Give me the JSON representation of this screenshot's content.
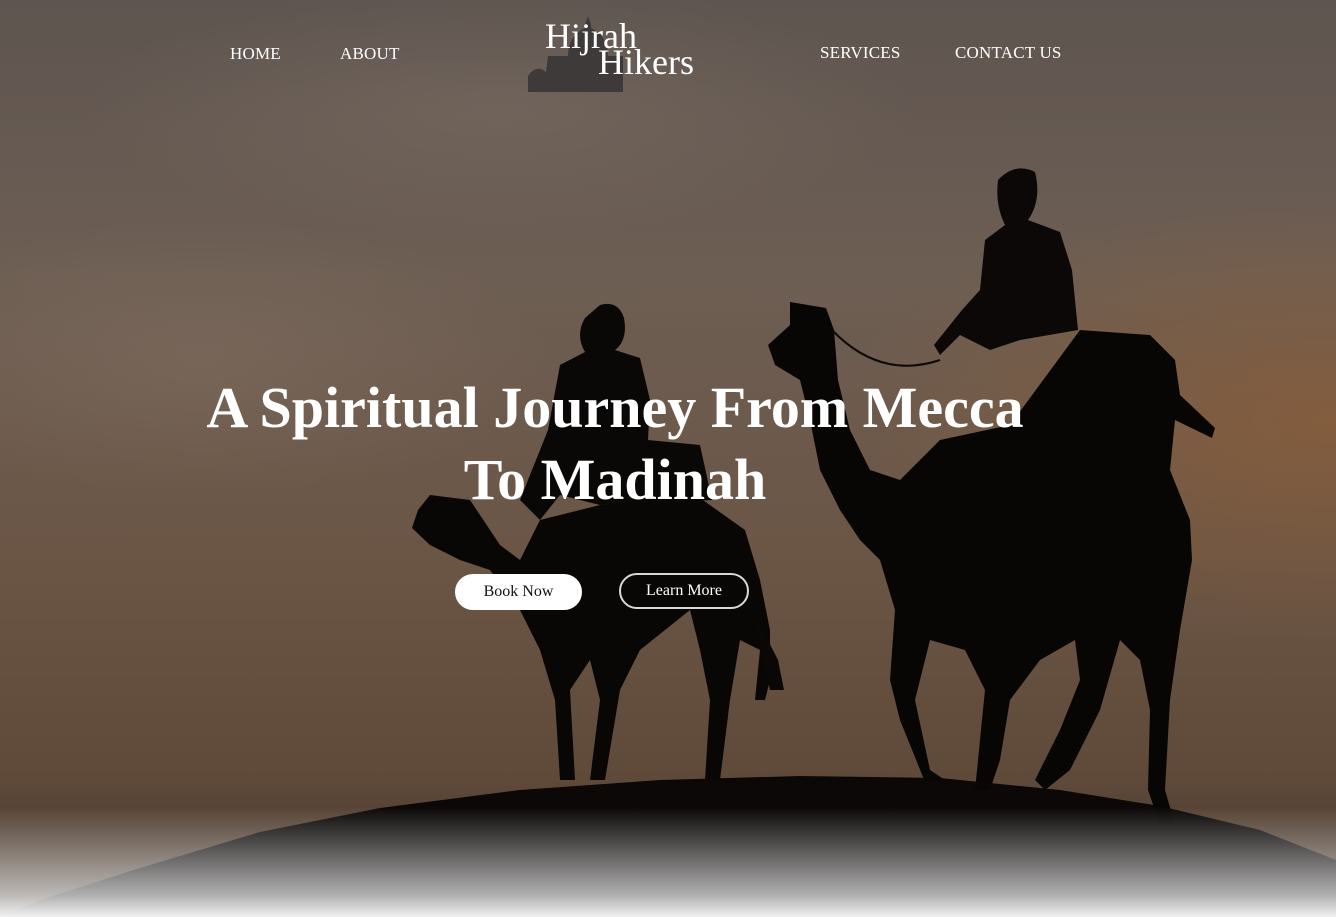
{
  "nav": {
    "home": "HOME",
    "about": "ABOUT",
    "services": "SERVICES",
    "contact": "CONTACT US"
  },
  "logo": {
    "line1": "Hijrah",
    "line2": "Hikers",
    "icon": "mosque-icon"
  },
  "hero": {
    "headline_line1": "A Spiritual Journey From Mecca",
    "headline_line2": "To Madinah",
    "primary_button": "Book Now",
    "secondary_button": "Learn More",
    "image": "camel-riders-silhouette"
  }
}
